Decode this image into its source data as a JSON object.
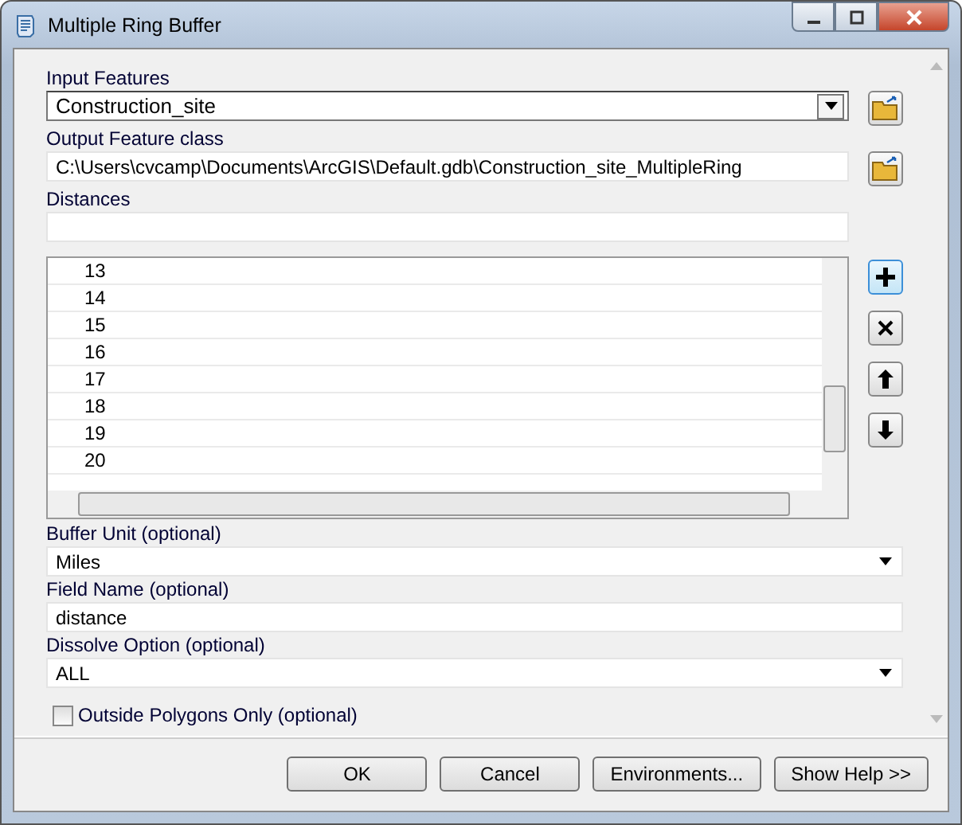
{
  "window": {
    "title": "Multiple Ring Buffer"
  },
  "input_features": {
    "label": "Input Features",
    "value": "Construction_site"
  },
  "output_feature_class": {
    "label": "Output Feature class",
    "value": "C:\\Users\\cvcamp\\Documents\\ArcGIS\\Default.gdb\\Construction_site_MultipleRing"
  },
  "distances": {
    "label": "Distances",
    "rows": [
      "13",
      "14",
      "15",
      "16",
      "17",
      "18",
      "19",
      "20"
    ]
  },
  "buffer_unit": {
    "label": "Buffer Unit (optional)",
    "value": "Miles"
  },
  "field_name": {
    "label": "Field Name (optional)",
    "value": "distance"
  },
  "dissolve_option": {
    "label": "Dissolve Option (optional)",
    "value": "ALL"
  },
  "outside_polygons_only": {
    "label": "Outside Polygons Only (optional)",
    "checked": false
  },
  "buttons": [
    "OK",
    "Cancel",
    "Environments...",
    "Show Help >>"
  ]
}
